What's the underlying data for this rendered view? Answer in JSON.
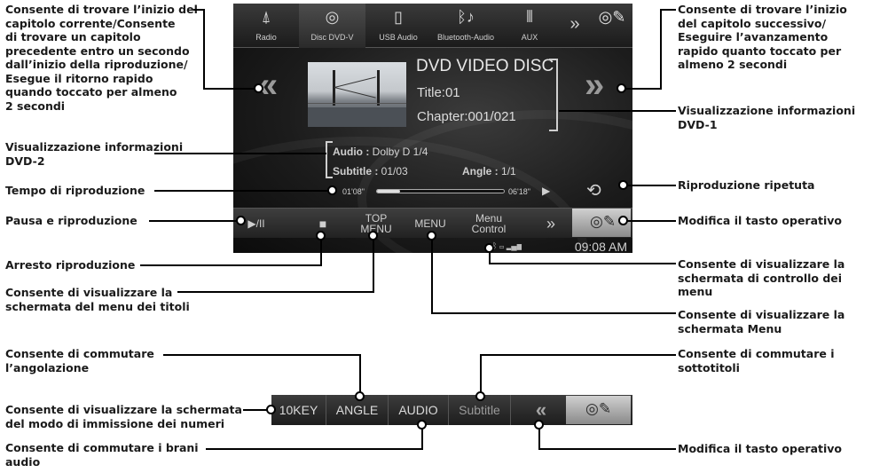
{
  "screen": {
    "sources": [
      {
        "label": "Radio",
        "icon": "antenna-icon"
      },
      {
        "label": "Disc DVD-V",
        "icon": "disc-icon"
      },
      {
        "label": "USB Audio",
        "icon": "usb-icon"
      },
      {
        "label": "Bluetooth-Audio",
        "icon": "bluetooth-music-icon"
      },
      {
        "label": "AUX",
        "icon": "aux-connector-icon"
      }
    ],
    "more_symbol": "»",
    "disc_type": "DVD VIDEO DISC",
    "title_line": "Title:01",
    "chapter_line": "Chapter:001/021",
    "audio_label": "Audio :",
    "audio_value": "Dolby D 1/4",
    "subtitle_label": "Subtitle :",
    "subtitle_value": "01/03",
    "angle_label": "Angle :",
    "angle_value": "1/1",
    "elapsed": "01'08\"",
    "total": "06'18\"",
    "progress": 0.18,
    "bottom": {
      "play_pause": "▶/II",
      "top_menu_1": "TOP",
      "top_menu_2": "MENU",
      "menu": "MENU",
      "menu_control_1": "Menu",
      "menu_control_2": "Control",
      "next_keys": "»"
    },
    "clock": "09:08 AM"
  },
  "bar2": {
    "key10": "10KEY",
    "angle": "ANGLE",
    "audio": "AUDIO",
    "subtitle": "Subtitle",
    "prev": "«"
  },
  "callouts": {
    "prev_chapter": "Consente di trovare l’inizio del\ncapitolo corrente/Consente\ndi trovare un capitolo\nprecedente entro un secondo\ndall’inizio della riproduzione/\nEsegue il ritorno rapido\nquando toccato per almeno\n2 secondi",
    "next_chapter": "Consente di trovare l’inizio\ndel capitolo successivo/\nEseguire l’avanzamento\nrapido quanto toccato per\nalmeno 2 secondi",
    "info1": "Visualizzazione informazioni\nDVD-1",
    "info2": "Visualizzazione informazioni\nDVD-2",
    "play_time": "Tempo di riproduzione",
    "repeat": "Riproduzione ripetuta",
    "pause_play": "Pausa e riproduzione",
    "change_key": "Modifica il tasto operativo",
    "stop": "Arresto riproduzione",
    "menu_control": "Consente di visualizzare la\nschermata di controllo dei\nmenu",
    "title_menu": "Consente di visualizzare la\nschermata del menu dei titoli",
    "menu_screen": "Consente di visualizzare la\nschermata Menu",
    "angle_switch": "Consente di commutare\nl’angolazione",
    "subtitle_switch": "Consente di commutare i\nsottotitoli",
    "number_input": "Consente di visualizzare la schermata\ndel modo di immissione dei numeri",
    "audio_switch": "Consente di commutare i brani\naudio",
    "change_key_2": "Modifica il tasto operativo"
  },
  "colors": {
    "screen_bg": "#1c1c1c",
    "leader": "#000000",
    "text": "#1a1a1a"
  }
}
